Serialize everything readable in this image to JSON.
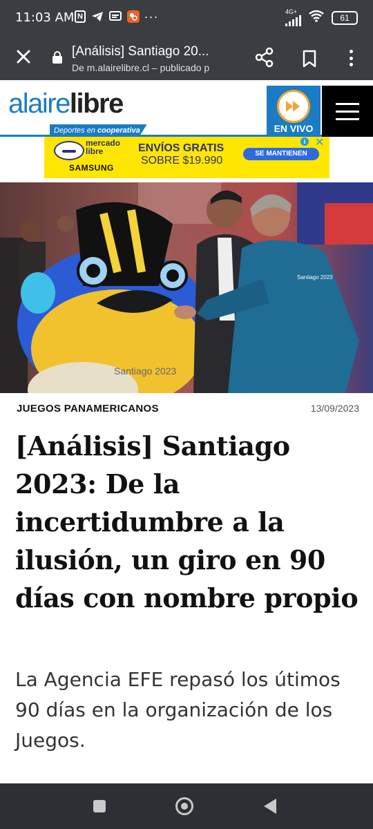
{
  "status_bar": {
    "time": "11:03 AM",
    "network_label": "4G+",
    "battery": "61",
    "left_icons": [
      "nfc-icon",
      "telegram-icon",
      "message-icon",
      "app-icon",
      "more-dots-icon"
    ],
    "right_icons": [
      "signal-icon",
      "wifi-icon",
      "battery-icon"
    ]
  },
  "browser": {
    "title": "[Análisis] Santiago 20...",
    "url_line": "De m.alairelibre.cl – publicado p",
    "icons": [
      "close-icon",
      "lock-icon",
      "share-icon",
      "bookmark-icon",
      "more-vert-icon"
    ]
  },
  "site": {
    "logo_part1": "alaire",
    "logo_part2": "libre",
    "logo_tag_prefix": "Deportes en ",
    "logo_tag_brand": "cooperativa",
    "live_label": "EN VIVO"
  },
  "ad": {
    "brand_line1": "mercado",
    "brand_line2": "libre",
    "samsung": "SAMSUNG",
    "line1": "ENVÍOS GRATIS",
    "line2": "SOBRE $19.990",
    "button": "SE MANTIENEN",
    "accent": "#ffe601"
  },
  "article": {
    "category": "JUEGOS PANAMERICANOS",
    "date": "13/09/2023",
    "headline": "[Análisis] Santiago 2023: De la incertidumbre a la ilusión, un giro en 90 días con nombre propio",
    "lead": "La Agencia EFE repasó los útimos 90 días en la organización de los Juegos.",
    "image_text_mascot": "Santiago 2023",
    "image_text_jacket": "Santiago 2023"
  },
  "colors": {
    "brand_blue": "#1b7cc4",
    "toolbar_bg": "#3a3d42",
    "nav_bg": "#2c2f33"
  }
}
